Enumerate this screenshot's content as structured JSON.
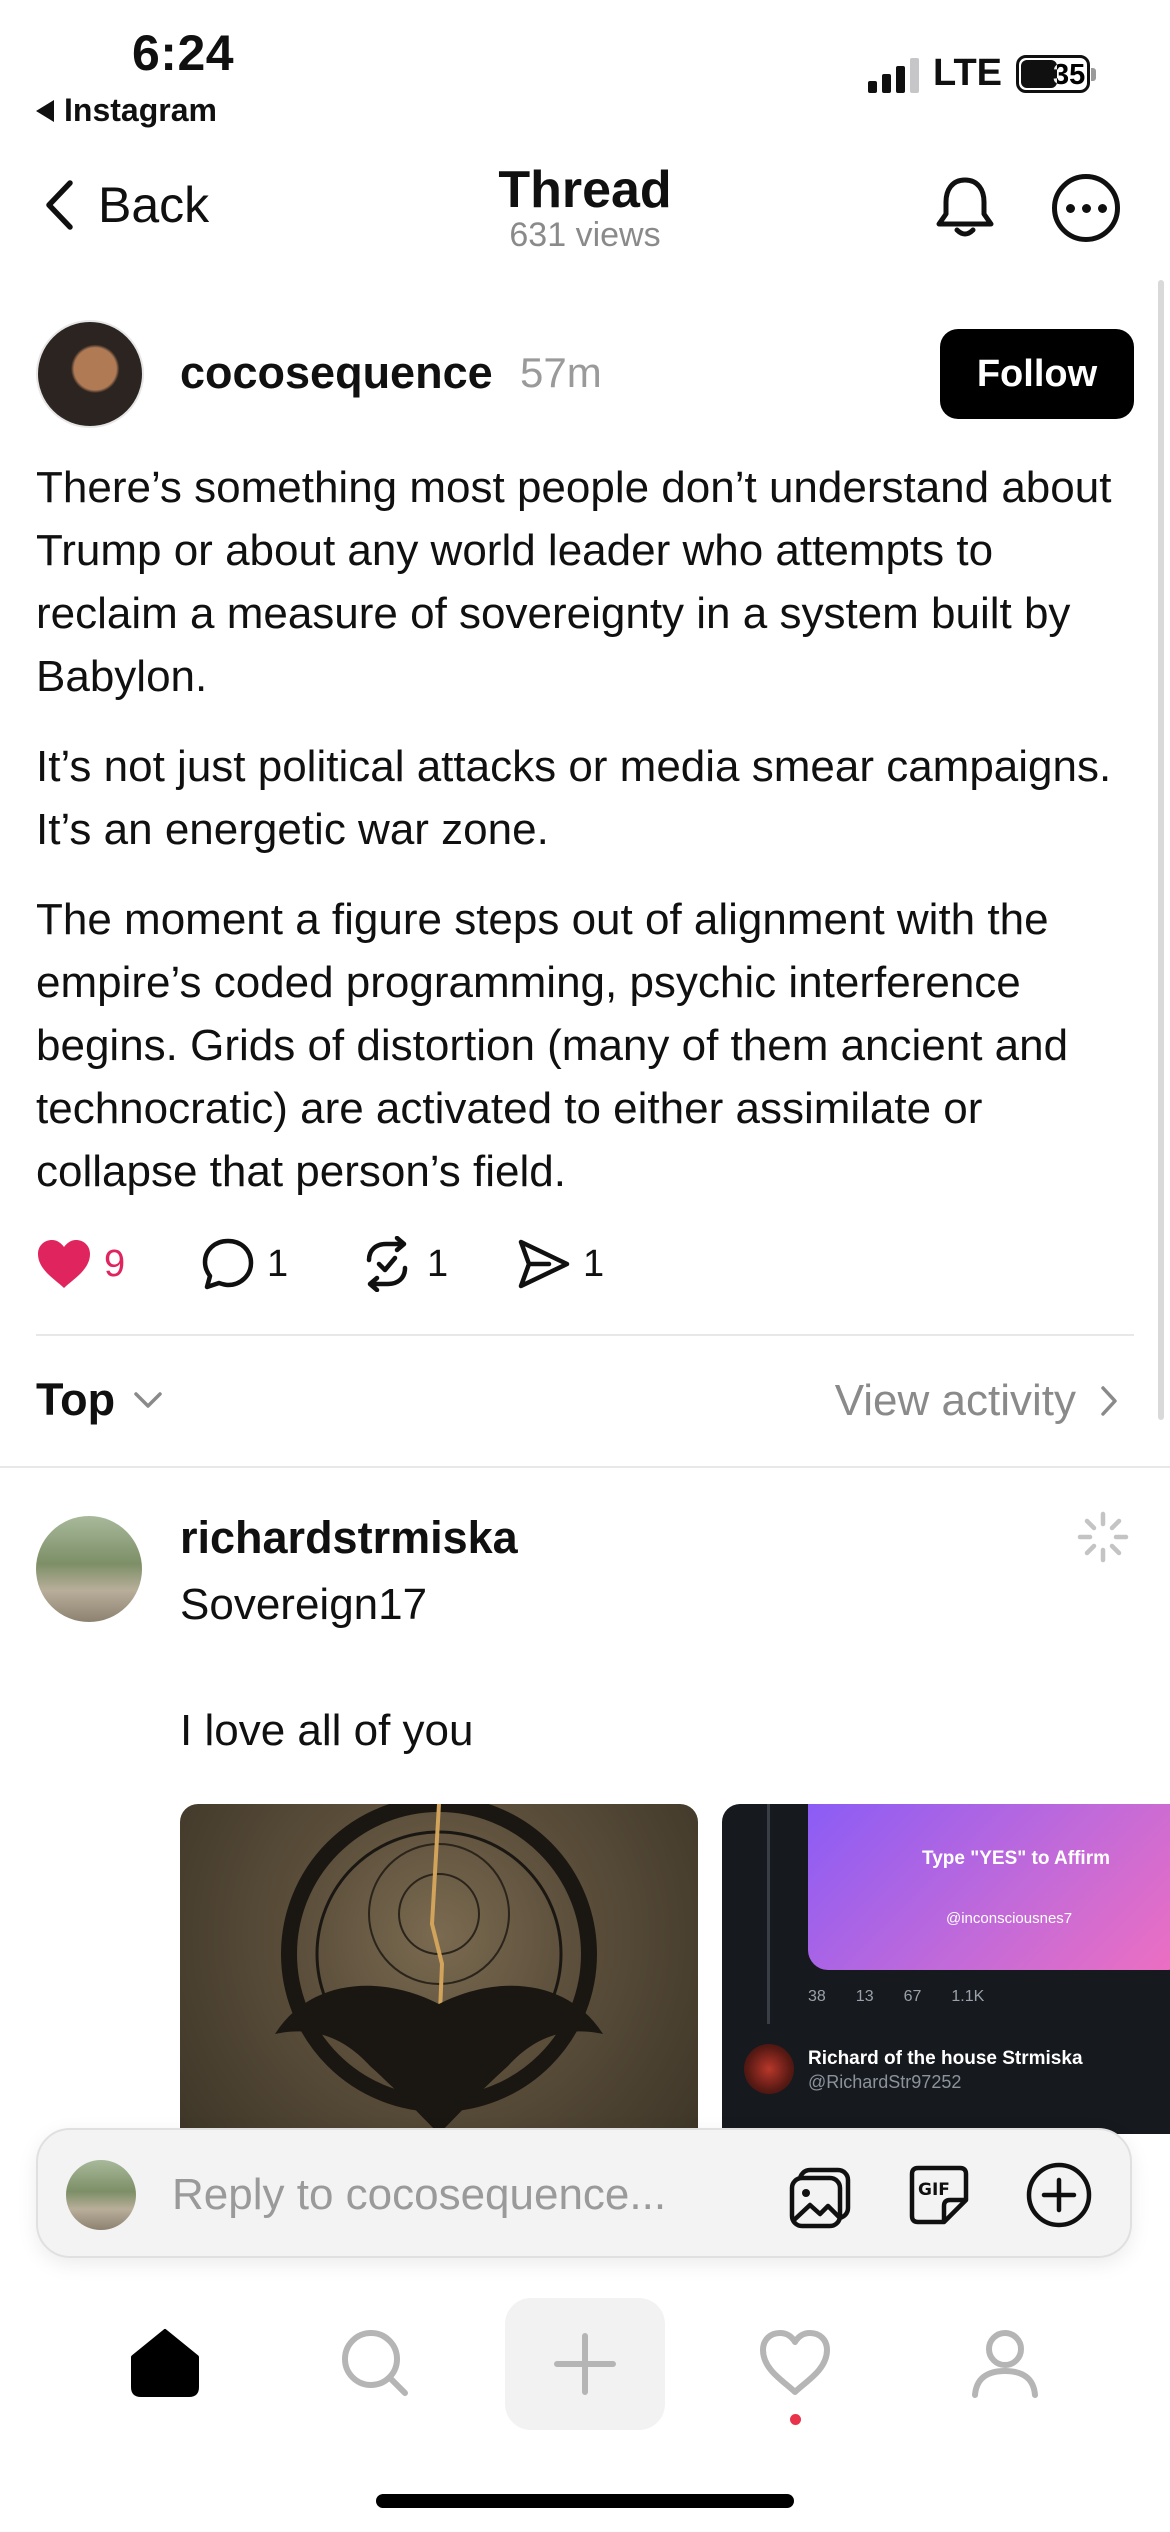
{
  "status_bar": {
    "time": "6:24",
    "back_app": "Instagram",
    "network": "LTE",
    "battery": "35"
  },
  "header": {
    "back_label": "Back",
    "title": "Thread",
    "subtitle": "631 views"
  },
  "post": {
    "username": "cocosequence",
    "time": "57m",
    "follow_label": "Follow",
    "paragraphs": [
      "There’s something most people don’t understand about Trump or about any world leader who attempts to reclaim a measure of sovereignty in a system built by Babylon.",
      "It’s not just political attacks or media smear campaigns. It’s an energetic war zone.",
      "The moment a figure steps out of alignment with the empire’s coded programming, psychic interference begins. Grids of distortion (many of them ancient and technocratic) are activated to either assimilate or collapse that person’s field."
    ],
    "likes": "9",
    "comments": "1",
    "reposts": "1",
    "shares": "1",
    "liked_color": "#e0245e"
  },
  "sort": {
    "label": "Top",
    "view_activity": "View activity"
  },
  "reply": {
    "username": "richardstrmiska",
    "line1": "Sovereign17",
    "line2": "I love all of you",
    "image2": {
      "promo_title": "Type \"YES\" to Affirm",
      "promo_handle": "@inconsciousnes7",
      "stats": [
        "38",
        "13",
        "67",
        "1.1K"
      ],
      "author_name": "Richard of the house Strmiska",
      "author_handle": "@RichardStr97252"
    }
  },
  "reply_bar": {
    "placeholder": "Reply to cocosequence..."
  },
  "icons": {
    "tabs": [
      "home-icon",
      "search-icon",
      "new-thread-icon",
      "activity-heart-icon",
      "profile-icon"
    ]
  }
}
